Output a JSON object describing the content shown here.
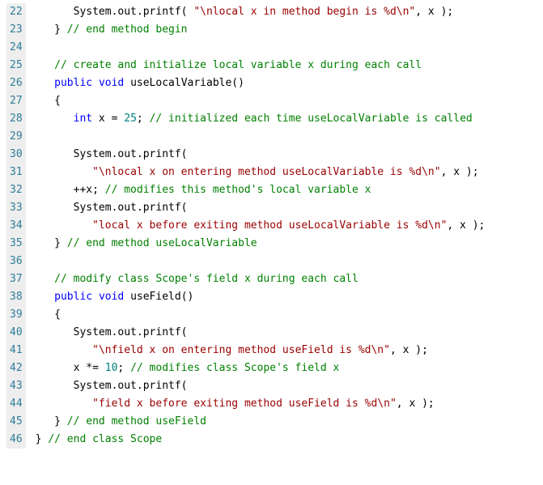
{
  "lines": [
    {
      "num": "22",
      "tokens": [
        {
          "cls": "t",
          "txt": "      System.out.printf( "
        },
        {
          "cls": "s",
          "txt": "\"\\nlocal x in method begin is %d\\n\""
        },
        {
          "cls": "t",
          "txt": ", x );"
        }
      ]
    },
    {
      "num": "23",
      "tokens": [
        {
          "cls": "t",
          "txt": "   } "
        },
        {
          "cls": "c",
          "txt": "// end method begin"
        }
      ]
    },
    {
      "num": "24",
      "tokens": [
        {
          "cls": "t",
          "txt": ""
        }
      ]
    },
    {
      "num": "25",
      "tokens": [
        {
          "cls": "t",
          "txt": "   "
        },
        {
          "cls": "c",
          "txt": "// create and initialize local variable x during each call"
        }
      ]
    },
    {
      "num": "26",
      "tokens": [
        {
          "cls": "t",
          "txt": "   "
        },
        {
          "cls": "k",
          "txt": "public"
        },
        {
          "cls": "t",
          "txt": " "
        },
        {
          "cls": "k",
          "txt": "void"
        },
        {
          "cls": "t",
          "txt": " useLocalVariable()"
        }
      ]
    },
    {
      "num": "27",
      "tokens": [
        {
          "cls": "t",
          "txt": "   {"
        }
      ]
    },
    {
      "num": "28",
      "tokens": [
        {
          "cls": "t",
          "txt": "      "
        },
        {
          "cls": "k",
          "txt": "int"
        },
        {
          "cls": "t",
          "txt": " x = "
        },
        {
          "cls": "n",
          "txt": "25"
        },
        {
          "cls": "t",
          "txt": "; "
        },
        {
          "cls": "c",
          "txt": "// initialized each time useLocalVariable is called"
        }
      ]
    },
    {
      "num": "29",
      "tokens": [
        {
          "cls": "t",
          "txt": ""
        }
      ]
    },
    {
      "num": "30",
      "tokens": [
        {
          "cls": "t",
          "txt": "      System.out.printf("
        }
      ]
    },
    {
      "num": "31",
      "tokens": [
        {
          "cls": "t",
          "txt": "         "
        },
        {
          "cls": "s",
          "txt": "\"\\nlocal x on entering method useLocalVariable is %d\\n\""
        },
        {
          "cls": "t",
          "txt": ", x );"
        }
      ]
    },
    {
      "num": "32",
      "tokens": [
        {
          "cls": "t",
          "txt": "      ++x; "
        },
        {
          "cls": "c",
          "txt": "// modifies this method's local variable x"
        }
      ]
    },
    {
      "num": "33",
      "tokens": [
        {
          "cls": "t",
          "txt": "      System.out.printf("
        }
      ]
    },
    {
      "num": "34",
      "tokens": [
        {
          "cls": "t",
          "txt": "         "
        },
        {
          "cls": "s",
          "txt": "\"local x before exiting method useLocalVariable is %d\\n\""
        },
        {
          "cls": "t",
          "txt": ", x );"
        }
      ]
    },
    {
      "num": "35",
      "tokens": [
        {
          "cls": "t",
          "txt": "   } "
        },
        {
          "cls": "c",
          "txt": "// end method useLocalVariable"
        }
      ]
    },
    {
      "num": "36",
      "tokens": [
        {
          "cls": "t",
          "txt": ""
        }
      ]
    },
    {
      "num": "37",
      "tokens": [
        {
          "cls": "t",
          "txt": "   "
        },
        {
          "cls": "c",
          "txt": "// modify class Scope's field x during each call"
        }
      ]
    },
    {
      "num": "38",
      "tokens": [
        {
          "cls": "t",
          "txt": "   "
        },
        {
          "cls": "k",
          "txt": "public"
        },
        {
          "cls": "t",
          "txt": " "
        },
        {
          "cls": "k",
          "txt": "void"
        },
        {
          "cls": "t",
          "txt": " useField()"
        }
      ]
    },
    {
      "num": "39",
      "tokens": [
        {
          "cls": "t",
          "txt": "   {"
        }
      ]
    },
    {
      "num": "40",
      "tokens": [
        {
          "cls": "t",
          "txt": "      System.out.printf("
        }
      ]
    },
    {
      "num": "41",
      "tokens": [
        {
          "cls": "t",
          "txt": "         "
        },
        {
          "cls": "s",
          "txt": "\"\\nfield x on entering method useField is %d\\n\""
        },
        {
          "cls": "t",
          "txt": ", x );"
        }
      ]
    },
    {
      "num": "42",
      "tokens": [
        {
          "cls": "t",
          "txt": "      x *= "
        },
        {
          "cls": "n",
          "txt": "10"
        },
        {
          "cls": "t",
          "txt": "; "
        },
        {
          "cls": "c",
          "txt": "// modifies class Scope's field x"
        }
      ]
    },
    {
      "num": "43",
      "tokens": [
        {
          "cls": "t",
          "txt": "      System.out.printf("
        }
      ]
    },
    {
      "num": "44",
      "tokens": [
        {
          "cls": "t",
          "txt": "         "
        },
        {
          "cls": "s",
          "txt": "\"field x before exiting method useField is %d\\n\""
        },
        {
          "cls": "t",
          "txt": ", x );"
        }
      ]
    },
    {
      "num": "45",
      "tokens": [
        {
          "cls": "t",
          "txt": "   } "
        },
        {
          "cls": "c",
          "txt": "// end method useField"
        }
      ]
    },
    {
      "num": "46",
      "tokens": [
        {
          "cls": "t",
          "txt": "} "
        },
        {
          "cls": "c",
          "txt": "// end class Scope"
        }
      ]
    }
  ]
}
